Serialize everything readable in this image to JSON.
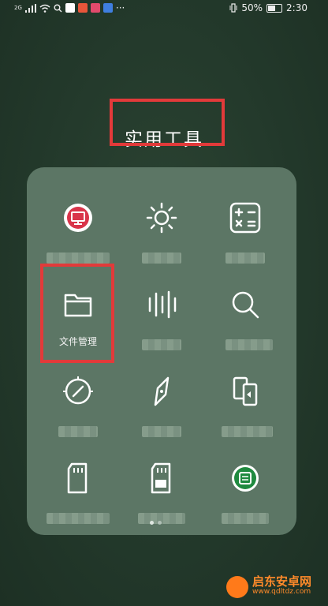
{
  "statusbar": {
    "signal_text": "2G",
    "battery": "50%",
    "time": "2:30"
  },
  "folder": {
    "title": "实用工具"
  },
  "apps": [
    {
      "icon": "monitor-app-icon",
      "label": ""
    },
    {
      "icon": "brightness-icon",
      "label": ""
    },
    {
      "icon": "calculator-icon",
      "label": ""
    },
    {
      "icon": "folder-icon",
      "label": "文件管理"
    },
    {
      "icon": "voice-recorder-icon",
      "label": ""
    },
    {
      "icon": "magnifier-icon",
      "label": ""
    },
    {
      "icon": "compass-dial-icon",
      "label": ""
    },
    {
      "icon": "compass-needle-icon",
      "label": ""
    },
    {
      "icon": "phone-clone-icon",
      "label": ""
    },
    {
      "icon": "sd-card-icon",
      "label": ""
    },
    {
      "icon": "sim-card-icon",
      "label": ""
    },
    {
      "icon": "backup-app-icon",
      "label": ""
    }
  ],
  "page_indicator": {
    "pages": 2,
    "current": 1
  },
  "watermark": {
    "name": "启东安卓网",
    "url": "www.qdltdz.com"
  }
}
